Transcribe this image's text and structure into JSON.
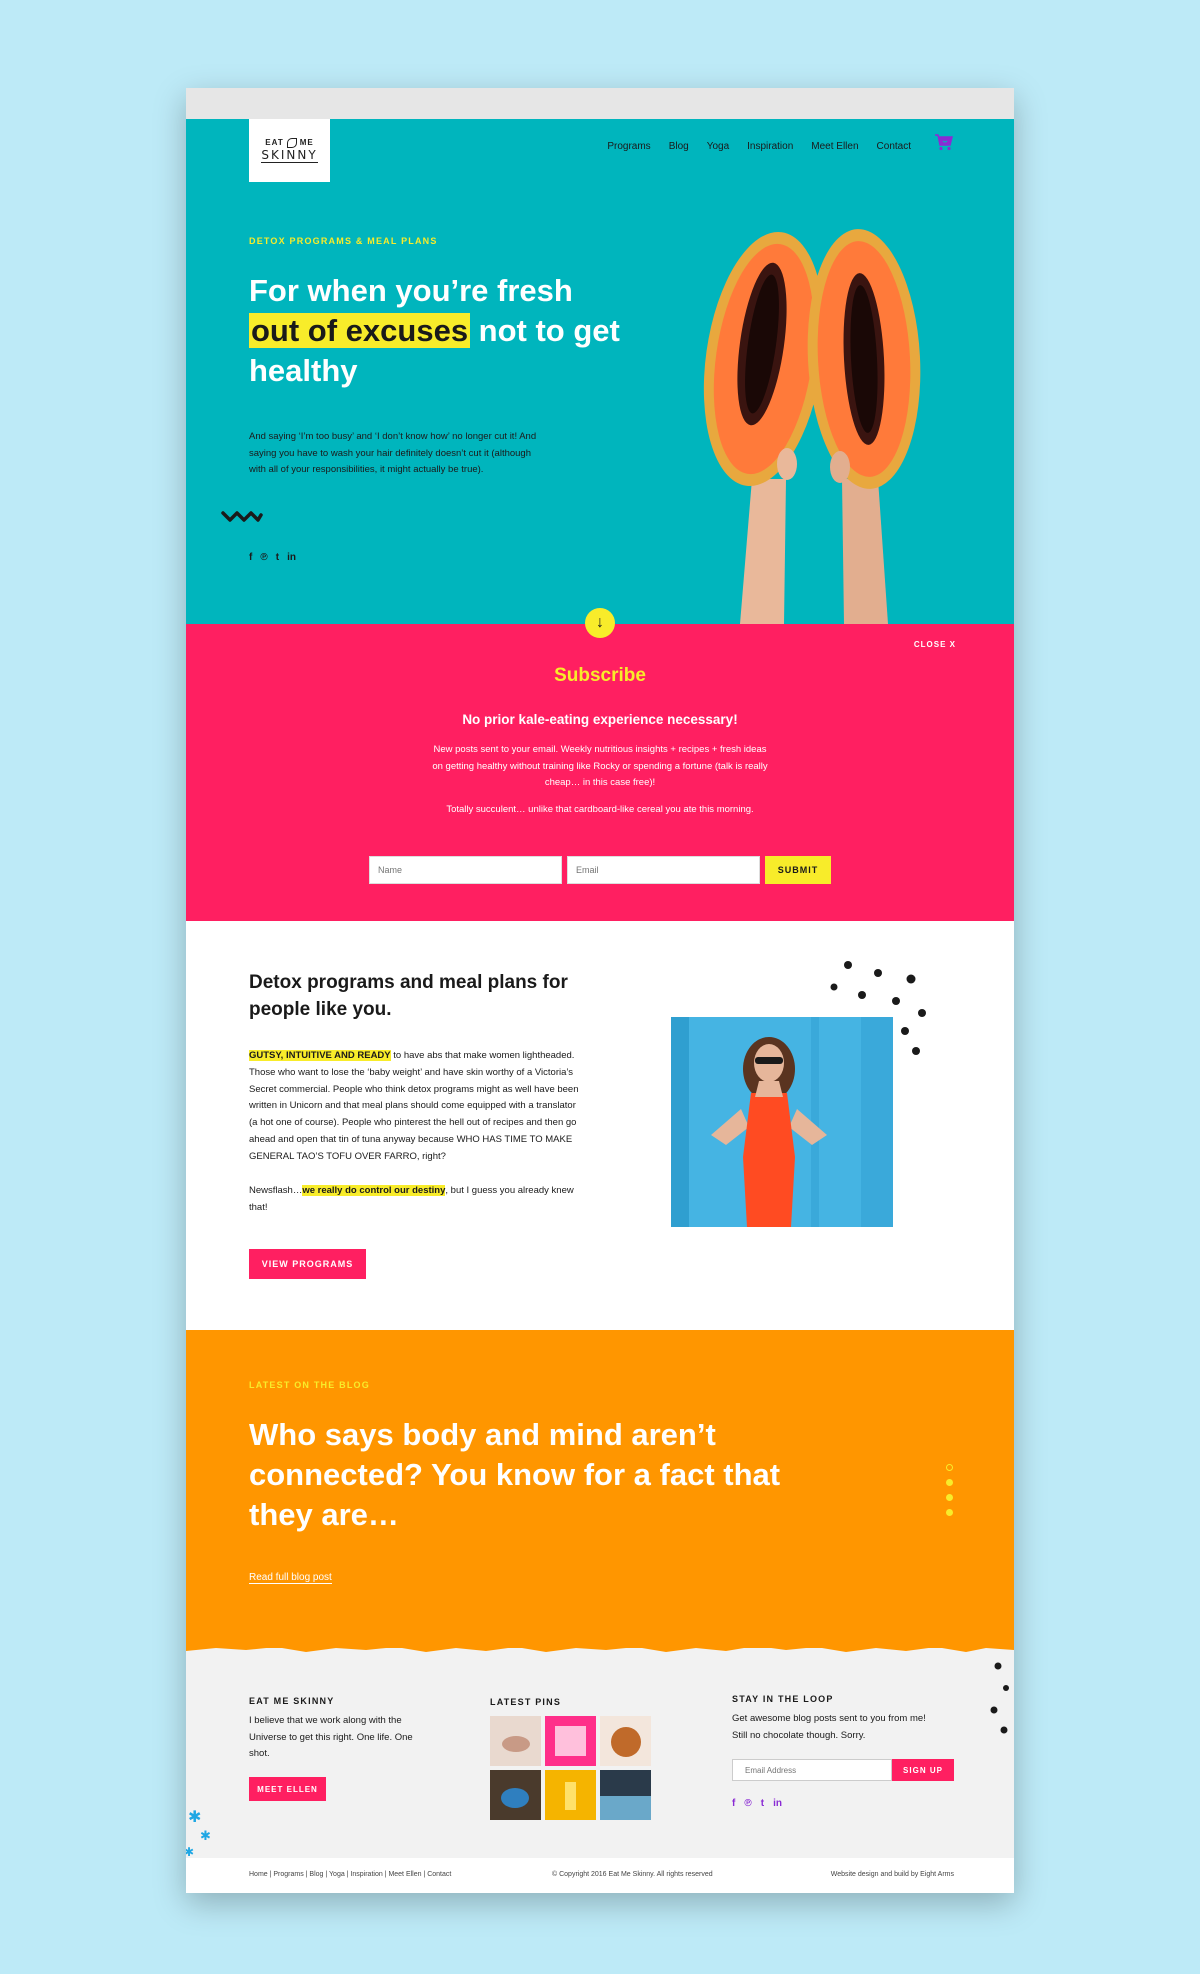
{
  "header": {
    "logo_top": "EAT ME",
    "logo_bottom": "SKINNY",
    "nav": [
      "Programs",
      "Blog",
      "Yoga",
      "Inspiration",
      "Meet Ellen",
      "Contact"
    ]
  },
  "hero": {
    "eyebrow": "DETOX PROGRAMS & MEAL PLANS",
    "headline_1": "For when you’re fresh",
    "headline_highlight": "out of excuses",
    "headline_2": " not to get healthy",
    "body": "And saying ‘I’m too busy’ and ‘I don’t know how’ no longer cut it! And saying you have to wash your hair definitely doesn’t cut it (although with all of your responsibilities, it might actually be true).",
    "socials": [
      "f",
      "℗",
      "t",
      "in"
    ]
  },
  "subscribe": {
    "close": "CLOSE X",
    "title": "Subscribe",
    "lead": "No prior kale-eating experience necessary!",
    "body": "New posts sent to your email. Weekly nutritious insights + recipes + fresh ideas on getting healthy without training like Rocky or spending a fortune (talk is really cheap… in this case free)!",
    "body2": "Totally succulent… unlike that cardboard-like cereal you ate this morning.",
    "name_placeholder": "Name",
    "email_placeholder": "Email",
    "submit": "SUBMIT"
  },
  "about": {
    "title": "Detox programs and meal plans for people like you.",
    "body_highlight": "GUTSY, INTUITIVE AND READY",
    "body_rest": " to have abs that make women lightheaded. Those who want to lose the ‘baby weight’ and have skin worthy of a Victoria’s Secret commercial. People who think detox programs might as well have been written in Unicorn and that meal plans should come equipped with a translator (a hot one of course). People who pinterest the hell out of recipes and then go ahead and open that tin of tuna anyway because WHO HAS TIME TO MAKE GENERAL TAO’S TOFU OVER FARRO, right?",
    "body2_pre": "Newsflash…",
    "body2_highlight": "we really do control our destiny",
    "body2_post": ", but I guess you already knew that!",
    "button": "VIEW PROGRAMS"
  },
  "blog": {
    "eyebrow": "LATEST ON THE BLOG",
    "title": "Who says body and mind aren’t connected? You know for a fact that they are…",
    "link": "Read full blog post"
  },
  "footer": {
    "col1_title": "EAT ME SKINNY",
    "col1_text": "I believe that we work along with the Universe to get this right. One life. One shot.",
    "col1_button": "MEET ELLEN",
    "col2_title": "LATEST PINS",
    "col3_title": "STAY IN THE LOOP",
    "col3_text": "Get awesome blog posts sent to you from me! Still no chocolate though. Sorry.",
    "email_placeholder": "Email Address",
    "signup": "SIGN UP",
    "socials": [
      "f",
      "℗",
      "t",
      "in"
    ],
    "links": "Home | Programs | Blog | Yoga | Inspiration | Meet Ellen | Contact",
    "copyright": "© Copyright 2016 Eat Me Skinny. All rights reserved",
    "credit": "Website design and build by Eight Arms"
  },
  "colors": {
    "teal": "#00b5bd",
    "pink": "#ff1f61",
    "yellow": "#f8ec2a",
    "orange": "#ff9600",
    "purple": "#8a2bd4"
  }
}
